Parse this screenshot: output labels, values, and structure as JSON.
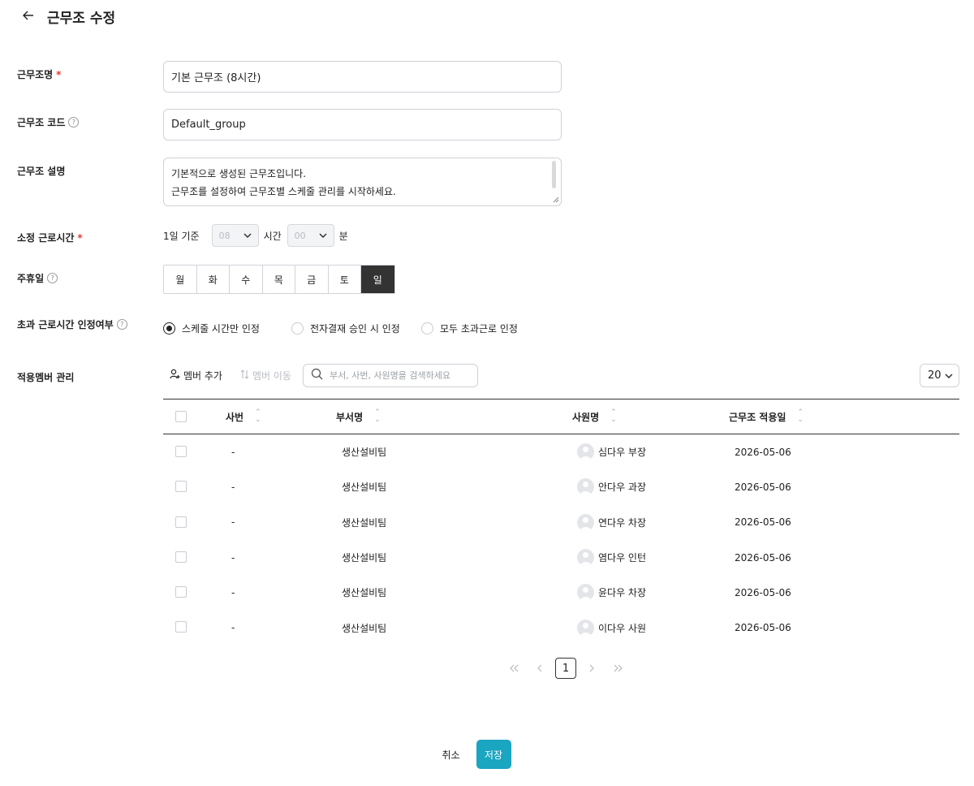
{
  "header": {
    "back_icon": "arrow-left-icon",
    "title": "근무조 수정"
  },
  "fields": {
    "name": {
      "label": "근무조명",
      "required_mark": "*",
      "value": "기본 근무조 (8시간)"
    },
    "code": {
      "label": "근무조 코드",
      "help_icon": "help-circle-icon",
      "value": "Default_group"
    },
    "description": {
      "label": "근무조 설명",
      "value": "기본적으로 생성된 근무조입니다.\n근무조를 설정하여 근무조별 스케줄 관리를 시작하세요."
    },
    "hours": {
      "label": "소정 근로시간",
      "required_mark": "*",
      "basis": "1일 기준",
      "hour_value": "08",
      "hour_unit": "시간",
      "minute_value": "00",
      "minute_unit": "분"
    },
    "holiday": {
      "label": "주휴일",
      "days": [
        "월",
        "화",
        "수",
        "목",
        "금",
        "토",
        "일"
      ],
      "selected": "일"
    },
    "overtime": {
      "label": "초과 근로시간 인정여부",
      "options": [
        "스케줄 시간만 인정",
        "전자결재 승인 시 인정",
        "모두 초과근로 인정"
      ],
      "selected": "스케줄 시간만 인정"
    }
  },
  "members": {
    "label": "적용멤버 관리",
    "add_label": "멤버 추가",
    "move_label": "멤버 이동",
    "search_placeholder": "부서, 사번, 사원명을 검색하세요",
    "page_size": "20",
    "columns": [
      "사번",
      "부서명",
      "사원명",
      "근무조 적용일"
    ],
    "rows": [
      {
        "emp_no": "-",
        "dept": "생산설비팀",
        "name": "심다우 부장",
        "date": "2026-05-06"
      },
      {
        "emp_no": "-",
        "dept": "생산설비팀",
        "name": "안다우 과장",
        "date": "2026-05-06"
      },
      {
        "emp_no": "-",
        "dept": "생산설비팀",
        "name": "연다우 차장",
        "date": "2026-05-06"
      },
      {
        "emp_no": "-",
        "dept": "생산설비팀",
        "name": "염다우 인턴",
        "date": "2026-05-06"
      },
      {
        "emp_no": "-",
        "dept": "생산설비팀",
        "name": "윤다우 차장",
        "date": "2026-05-06"
      },
      {
        "emp_no": "-",
        "dept": "생산설비팀",
        "name": "이다우 사원",
        "date": "2026-05-06"
      }
    ]
  },
  "pagination": {
    "current_page": "1"
  },
  "footer": {
    "cancel_label": "취소",
    "save_label": "저장",
    "save_color": "#1aa5c0"
  }
}
